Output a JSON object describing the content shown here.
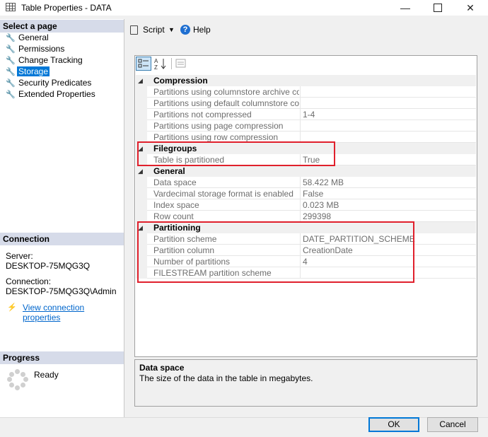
{
  "window": {
    "title": "Table Properties - DATA",
    "min": "—",
    "close": "✕"
  },
  "left": {
    "select_page_header": "Select a page",
    "pages": [
      {
        "label": "General"
      },
      {
        "label": "Permissions"
      },
      {
        "label": "Change Tracking"
      },
      {
        "label": "Storage"
      },
      {
        "label": "Security Predicates"
      },
      {
        "label": "Extended Properties"
      }
    ],
    "connection_header": "Connection",
    "server_label": "Server:",
    "server_value": "DESKTOP-75MQG3Q",
    "connection_label": "Connection:",
    "connection_value": "DESKTOP-75MQG3Q\\Admin",
    "view_connection_link": "View connection properties",
    "progress_header": "Progress",
    "progress_status": "Ready"
  },
  "toolbar": {
    "script_label": "Script",
    "help_label": "Help"
  },
  "grid": {
    "categories": {
      "compression": "Compression",
      "filegroups": "Filegroups",
      "general": "General",
      "partitioning": "Partitioning"
    },
    "compression_rows": [
      {
        "name": "Partitions using columnstore archive compre",
        "value": ""
      },
      {
        "name": "Partitions using default columnstore compres",
        "value": ""
      },
      {
        "name": "Partitions not compressed",
        "value": "1-4"
      },
      {
        "name": "Partitions using page compression",
        "value": ""
      },
      {
        "name": "Partitions using row compression",
        "value": ""
      }
    ],
    "filegroups_rows": [
      {
        "name": "Table is partitioned",
        "value": "True"
      }
    ],
    "general_rows": [
      {
        "name": "Data space",
        "value": "58.422 MB"
      },
      {
        "name": "Vardecimal storage format is enabled",
        "value": "False"
      },
      {
        "name": "Index space",
        "value": "0.023 MB"
      },
      {
        "name": "Row count",
        "value": "299398"
      }
    ],
    "partitioning_rows": [
      {
        "name": "Partition scheme",
        "value": "DATE_PARTITION_SCHEME"
      },
      {
        "name": "Partition column",
        "value": "CreationDate"
      },
      {
        "name": "Number of partitions",
        "value": "4"
      },
      {
        "name": "FILESTREAM partition scheme",
        "value": ""
      }
    ]
  },
  "description": {
    "title": "Data space",
    "text": "The size of the data in the table in megabytes."
  },
  "buttons": {
    "ok": "OK",
    "cancel": "Cancel"
  },
  "colors": {
    "accent": "#0078d7",
    "highlight": "#e0202c",
    "section": "#d6dbe9"
  }
}
